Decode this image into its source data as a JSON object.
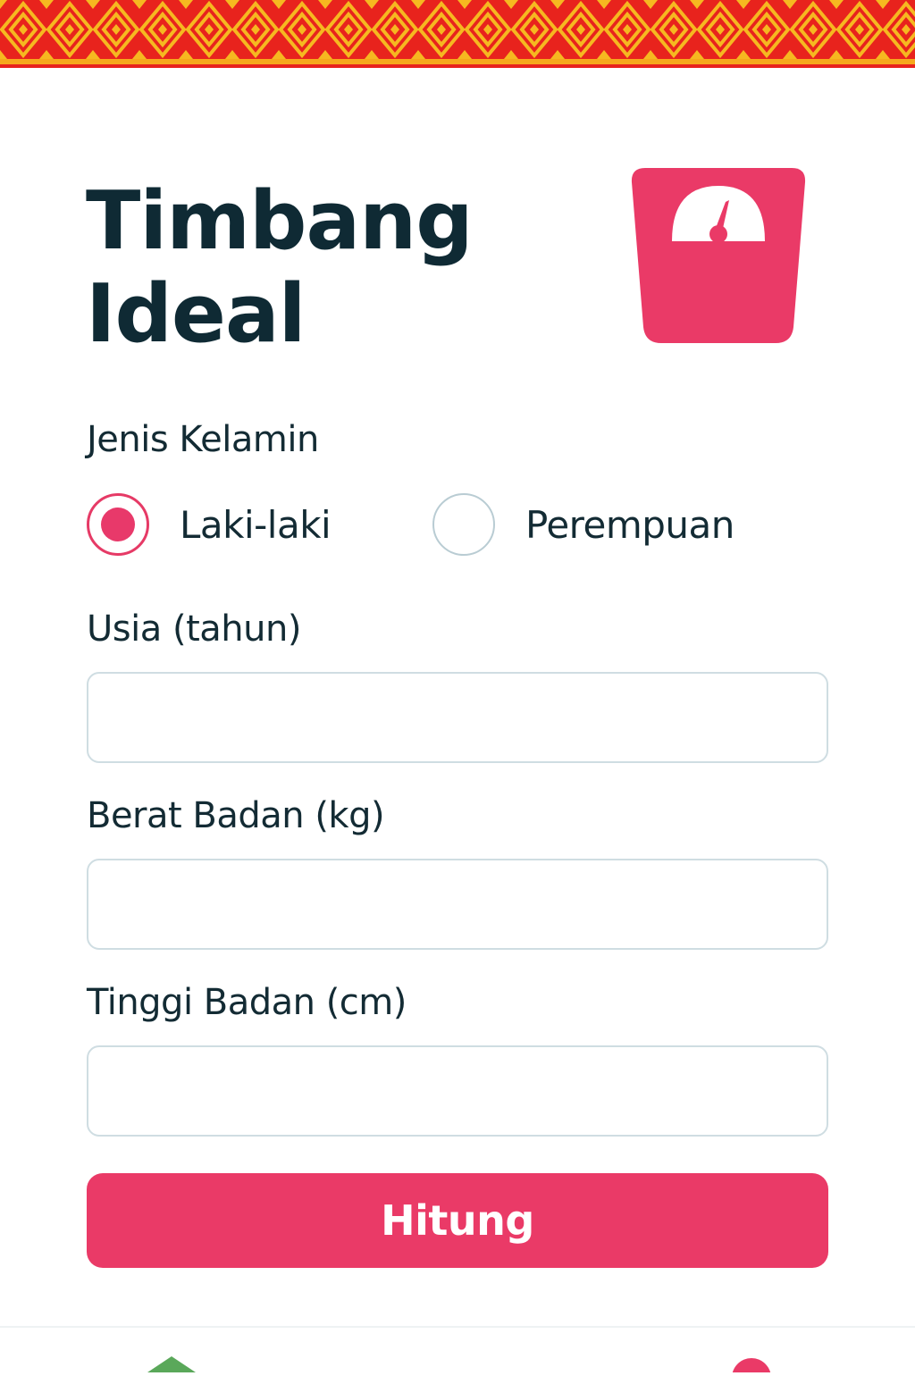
{
  "app": {
    "title_line1": "Timbang",
    "title_line2": "Ideal"
  },
  "gender": {
    "label": "Jenis Kelamin",
    "options": [
      {
        "label": "Laki-laki",
        "selected": true
      },
      {
        "label": "Perempuan",
        "selected": false
      }
    ]
  },
  "age": {
    "label": "Usia (tahun)",
    "value": "",
    "placeholder": ""
  },
  "weight": {
    "label": "Berat Badan (kg)",
    "value": "",
    "placeholder": ""
  },
  "height": {
    "label": "Tinggi Badan (cm)",
    "value": "",
    "placeholder": ""
  },
  "actions": {
    "calculate_label": "Hitung"
  },
  "icons": {
    "header": "scale-icon",
    "bottom_left": "home-icon",
    "bottom_right": "profile-icon"
  },
  "colors": {
    "accent": "#ea3a67",
    "banner_red": "#e8231d",
    "banner_yellow": "#f6b820",
    "text_dark": "#0f2a34",
    "input_border": "#cfdde2",
    "nav_green": "#5aa85a"
  }
}
